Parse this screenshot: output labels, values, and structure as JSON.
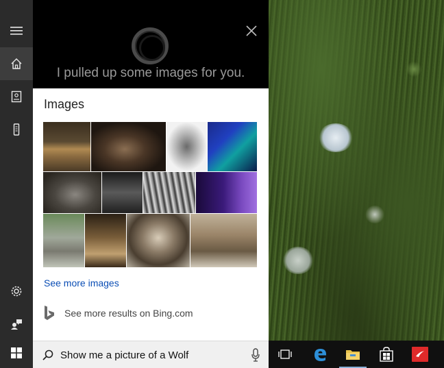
{
  "rail": {
    "items": [
      {
        "name": "menu-icon"
      },
      {
        "name": "home-icon"
      },
      {
        "name": "notebook-icon"
      },
      {
        "name": "device-icon"
      },
      {
        "name": "settings-icon"
      },
      {
        "name": "feedback-icon"
      },
      {
        "name": "start-icon"
      }
    ]
  },
  "header": {
    "message": "I pulled up some images for you."
  },
  "images": {
    "title": "Images",
    "see_more": "See more images"
  },
  "bing": {
    "text": "See more results on Bing.com"
  },
  "search": {
    "query": "Show me a picture of a Wolf"
  },
  "taskbar": {
    "apps": [
      "task-view-icon",
      "edge-icon",
      "file-explorer-icon",
      "store-icon",
      "app-icon"
    ]
  },
  "colors": {
    "accent_link": "#0b4eb5",
    "rail_bg": "#2b2b2b",
    "header_bg": "#000000",
    "taskbar_bg": "#101010"
  }
}
